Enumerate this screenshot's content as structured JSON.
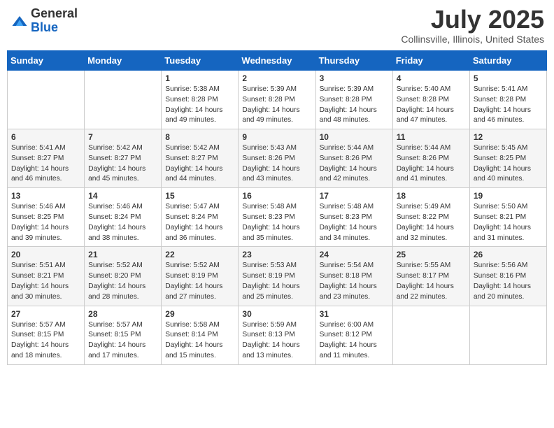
{
  "header": {
    "logo_general": "General",
    "logo_blue": "Blue",
    "month_title": "July 2025",
    "location": "Collinsville, Illinois, United States"
  },
  "weekdays": [
    "Sunday",
    "Monday",
    "Tuesday",
    "Wednesday",
    "Thursday",
    "Friday",
    "Saturday"
  ],
  "weeks": [
    [
      {
        "day": "",
        "sunrise": "",
        "sunset": "",
        "daylight": ""
      },
      {
        "day": "",
        "sunrise": "",
        "sunset": "",
        "daylight": ""
      },
      {
        "day": "1",
        "sunrise": "Sunrise: 5:38 AM",
        "sunset": "Sunset: 8:28 PM",
        "daylight": "Daylight: 14 hours and 49 minutes."
      },
      {
        "day": "2",
        "sunrise": "Sunrise: 5:39 AM",
        "sunset": "Sunset: 8:28 PM",
        "daylight": "Daylight: 14 hours and 49 minutes."
      },
      {
        "day": "3",
        "sunrise": "Sunrise: 5:39 AM",
        "sunset": "Sunset: 8:28 PM",
        "daylight": "Daylight: 14 hours and 48 minutes."
      },
      {
        "day": "4",
        "sunrise": "Sunrise: 5:40 AM",
        "sunset": "Sunset: 8:28 PM",
        "daylight": "Daylight: 14 hours and 47 minutes."
      },
      {
        "day": "5",
        "sunrise": "Sunrise: 5:41 AM",
        "sunset": "Sunset: 8:28 PM",
        "daylight": "Daylight: 14 hours and 46 minutes."
      }
    ],
    [
      {
        "day": "6",
        "sunrise": "Sunrise: 5:41 AM",
        "sunset": "Sunset: 8:27 PM",
        "daylight": "Daylight: 14 hours and 46 minutes."
      },
      {
        "day": "7",
        "sunrise": "Sunrise: 5:42 AM",
        "sunset": "Sunset: 8:27 PM",
        "daylight": "Daylight: 14 hours and 45 minutes."
      },
      {
        "day": "8",
        "sunrise": "Sunrise: 5:42 AM",
        "sunset": "Sunset: 8:27 PM",
        "daylight": "Daylight: 14 hours and 44 minutes."
      },
      {
        "day": "9",
        "sunrise": "Sunrise: 5:43 AM",
        "sunset": "Sunset: 8:26 PM",
        "daylight": "Daylight: 14 hours and 43 minutes."
      },
      {
        "day": "10",
        "sunrise": "Sunrise: 5:44 AM",
        "sunset": "Sunset: 8:26 PM",
        "daylight": "Daylight: 14 hours and 42 minutes."
      },
      {
        "day": "11",
        "sunrise": "Sunrise: 5:44 AM",
        "sunset": "Sunset: 8:26 PM",
        "daylight": "Daylight: 14 hours and 41 minutes."
      },
      {
        "day": "12",
        "sunrise": "Sunrise: 5:45 AM",
        "sunset": "Sunset: 8:25 PM",
        "daylight": "Daylight: 14 hours and 40 minutes."
      }
    ],
    [
      {
        "day": "13",
        "sunrise": "Sunrise: 5:46 AM",
        "sunset": "Sunset: 8:25 PM",
        "daylight": "Daylight: 14 hours and 39 minutes."
      },
      {
        "day": "14",
        "sunrise": "Sunrise: 5:46 AM",
        "sunset": "Sunset: 8:24 PM",
        "daylight": "Daylight: 14 hours and 38 minutes."
      },
      {
        "day": "15",
        "sunrise": "Sunrise: 5:47 AM",
        "sunset": "Sunset: 8:24 PM",
        "daylight": "Daylight: 14 hours and 36 minutes."
      },
      {
        "day": "16",
        "sunrise": "Sunrise: 5:48 AM",
        "sunset": "Sunset: 8:23 PM",
        "daylight": "Daylight: 14 hours and 35 minutes."
      },
      {
        "day": "17",
        "sunrise": "Sunrise: 5:48 AM",
        "sunset": "Sunset: 8:23 PM",
        "daylight": "Daylight: 14 hours and 34 minutes."
      },
      {
        "day": "18",
        "sunrise": "Sunrise: 5:49 AM",
        "sunset": "Sunset: 8:22 PM",
        "daylight": "Daylight: 14 hours and 32 minutes."
      },
      {
        "day": "19",
        "sunrise": "Sunrise: 5:50 AM",
        "sunset": "Sunset: 8:21 PM",
        "daylight": "Daylight: 14 hours and 31 minutes."
      }
    ],
    [
      {
        "day": "20",
        "sunrise": "Sunrise: 5:51 AM",
        "sunset": "Sunset: 8:21 PM",
        "daylight": "Daylight: 14 hours and 30 minutes."
      },
      {
        "day": "21",
        "sunrise": "Sunrise: 5:52 AM",
        "sunset": "Sunset: 8:20 PM",
        "daylight": "Daylight: 14 hours and 28 minutes."
      },
      {
        "day": "22",
        "sunrise": "Sunrise: 5:52 AM",
        "sunset": "Sunset: 8:19 PM",
        "daylight": "Daylight: 14 hours and 27 minutes."
      },
      {
        "day": "23",
        "sunrise": "Sunrise: 5:53 AM",
        "sunset": "Sunset: 8:19 PM",
        "daylight": "Daylight: 14 hours and 25 minutes."
      },
      {
        "day": "24",
        "sunrise": "Sunrise: 5:54 AM",
        "sunset": "Sunset: 8:18 PM",
        "daylight": "Daylight: 14 hours and 23 minutes."
      },
      {
        "day": "25",
        "sunrise": "Sunrise: 5:55 AM",
        "sunset": "Sunset: 8:17 PM",
        "daylight": "Daylight: 14 hours and 22 minutes."
      },
      {
        "day": "26",
        "sunrise": "Sunrise: 5:56 AM",
        "sunset": "Sunset: 8:16 PM",
        "daylight": "Daylight: 14 hours and 20 minutes."
      }
    ],
    [
      {
        "day": "27",
        "sunrise": "Sunrise: 5:57 AM",
        "sunset": "Sunset: 8:15 PM",
        "daylight": "Daylight: 14 hours and 18 minutes."
      },
      {
        "day": "28",
        "sunrise": "Sunrise: 5:57 AM",
        "sunset": "Sunset: 8:15 PM",
        "daylight": "Daylight: 14 hours and 17 minutes."
      },
      {
        "day": "29",
        "sunrise": "Sunrise: 5:58 AM",
        "sunset": "Sunset: 8:14 PM",
        "daylight": "Daylight: 14 hours and 15 minutes."
      },
      {
        "day": "30",
        "sunrise": "Sunrise: 5:59 AM",
        "sunset": "Sunset: 8:13 PM",
        "daylight": "Daylight: 14 hours and 13 minutes."
      },
      {
        "day": "31",
        "sunrise": "Sunrise: 6:00 AM",
        "sunset": "Sunset: 8:12 PM",
        "daylight": "Daylight: 14 hours and 11 minutes."
      },
      {
        "day": "",
        "sunrise": "",
        "sunset": "",
        "daylight": ""
      },
      {
        "day": "",
        "sunrise": "",
        "sunset": "",
        "daylight": ""
      }
    ]
  ]
}
